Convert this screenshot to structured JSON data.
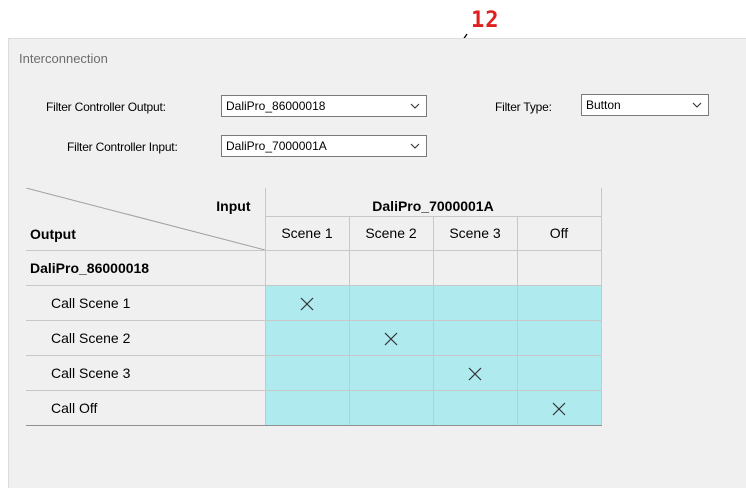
{
  "annotation": {
    "label": "12",
    "color": "#e02020"
  },
  "panel": {
    "title": "Interconnection"
  },
  "filters": {
    "controller_output_label": "Filter Controller Output:",
    "controller_output_value": "DaliPro_86000018",
    "controller_input_label": "Filter Controller Input:",
    "controller_input_value": "DaliPro_7000001A",
    "type_label": "Filter Type:",
    "type_value": "Button"
  },
  "matrix": {
    "input_label": "Input",
    "output_label": "Output",
    "input_controller": "DaliPro_7000001A",
    "output_controller": "DaliPro_86000018",
    "columns": [
      "Scene 1",
      "Scene 2",
      "Scene 3",
      "Off"
    ],
    "rows": [
      {
        "label": "Call Scene 1",
        "connected": [
          true,
          false,
          false,
          false
        ]
      },
      {
        "label": "Call Scene 2",
        "connected": [
          false,
          true,
          false,
          false
        ]
      },
      {
        "label": "Call Scene 3",
        "connected": [
          false,
          false,
          true,
          false
        ]
      },
      {
        "label": "Call Off",
        "connected": [
          false,
          false,
          false,
          true
        ]
      }
    ],
    "cell_color": "#afeaee"
  }
}
